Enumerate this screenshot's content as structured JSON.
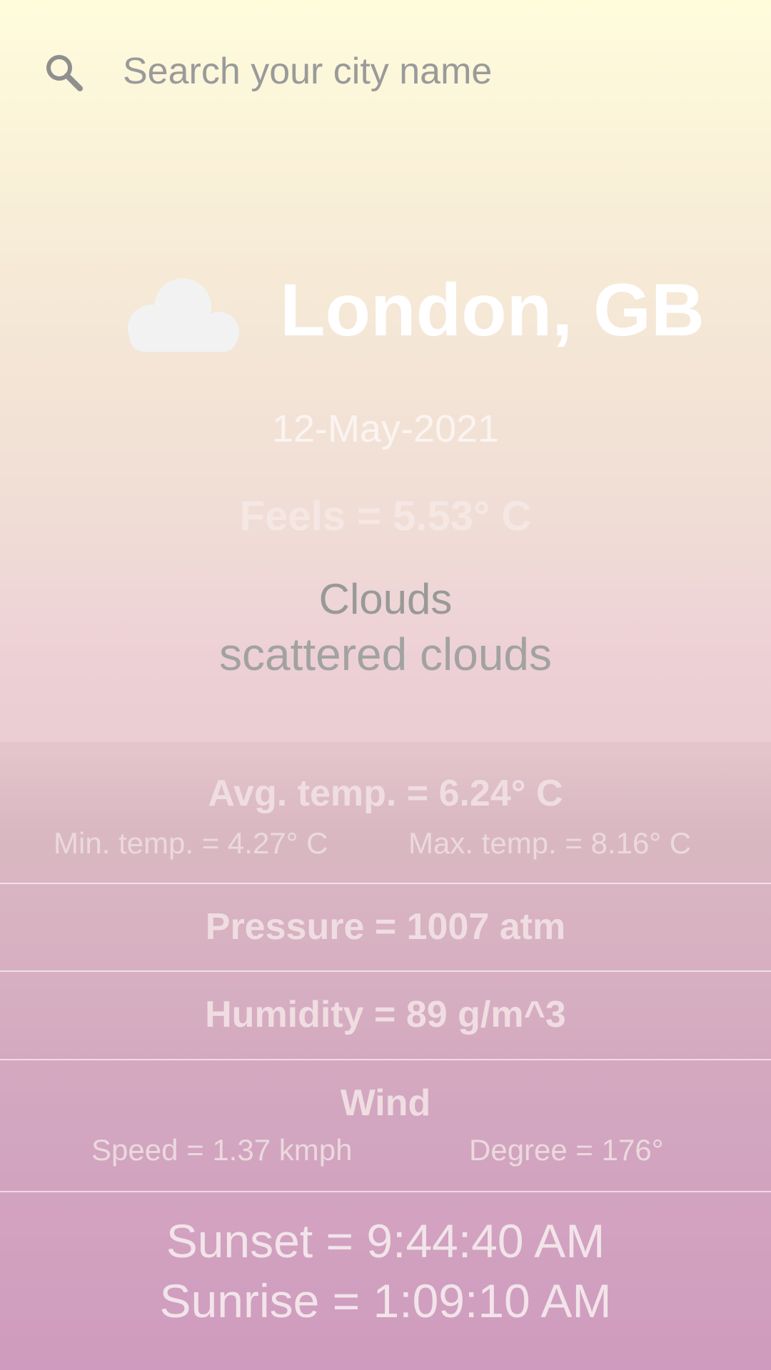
{
  "search": {
    "placeholder": "Search your city name",
    "icon": "search-icon"
  },
  "location": {
    "city": "London, GB",
    "weather_icon": "cloud-icon"
  },
  "date": "12-May-2021",
  "feels": "Feels = 5.53° C",
  "weather": {
    "main": "Clouds",
    "description": "scattered clouds"
  },
  "stats": {
    "avg_temp": "Avg. temp. = 6.24° C",
    "min_temp": "Min. temp. = 4.27° C",
    "max_temp": "Max. temp. = 8.16° C",
    "pressure": "Pressure = 1007 atm",
    "humidity": "Humidity = 89 g/m^3",
    "wind_title": "Wind",
    "wind_speed": "Speed = 1.37 kmph",
    "wind_degree": "Degree = 176°",
    "sunset": "Sunset = 9:44:40 AM",
    "sunrise": "Sunrise = 1:09:10 AM"
  },
  "colors": {
    "gradient_top": "#fffcdc",
    "gradient_bottom": "#cf9bbe",
    "city_text": "#ffffff",
    "muted_text": "#999999"
  }
}
